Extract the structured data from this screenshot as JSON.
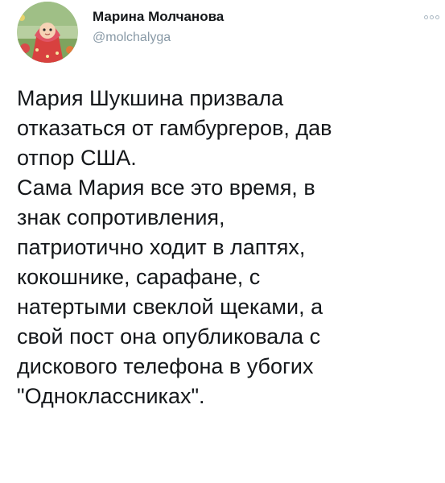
{
  "author": {
    "name": "Марина Молчанова",
    "handle": "@molchalyga",
    "avatar_icon": "avatar-masha-image"
  },
  "menu": {
    "icon": "more-options-icon"
  },
  "tweet": {
    "lines": [
      "Мария Шукшина призвала",
      "отказаться от гамбургеров, дав",
      "отпор США.",
      "Сама Мария все это время, в",
      "знак сопротивления,",
      "патриотично ходит в лаптях,",
      "кокошнике, сарафане, с",
      "натертыми свеклой щеками, а",
      "свой пост она опубликовала с",
      "дискового телефона в убогих",
      "\"Одноклассниках\"."
    ]
  },
  "colors": {
    "text": "#14171a",
    "secondary": "#8899a6",
    "background": "#ffffff"
  }
}
